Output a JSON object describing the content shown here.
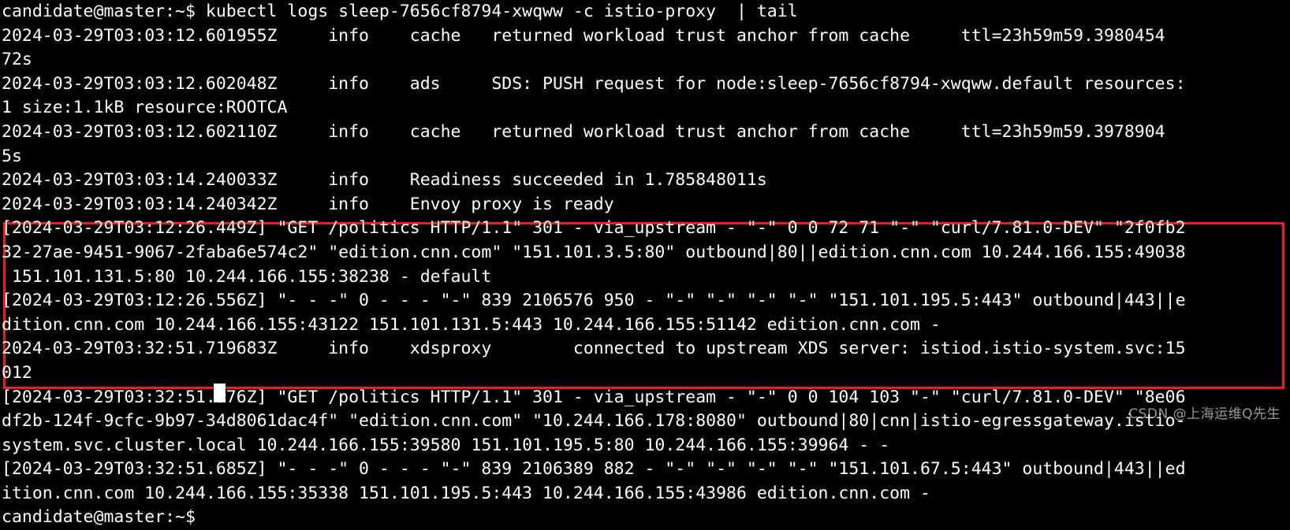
{
  "terminal": {
    "prompt": "candidate@master:~$",
    "command": "kubectl logs sleep-7656cf8794-xwqww -c istio-proxy  | tail",
    "background_color": "#000000",
    "text_color": "#ffffff",
    "highlight_color": "#f01b1b",
    "cursor": "block-cursor",
    "lines": [
      "candidate@master:~$ kubectl logs sleep-7656cf8794-xwqww -c istio-proxy  | tail",
      "2024-03-29T03:03:12.601955Z     info    cache   returned workload trust anchor from cache     ttl=23h59m59.3980454",
      "72s",
      "2024-03-29T03:03:12.602048Z     info    ads     SDS: PUSH request for node:sleep-7656cf8794-xwqww.default resources:",
      "1 size:1.1kB resource:ROOTCA",
      "2024-03-29T03:03:12.602110Z     info    cache   returned workload trust anchor from cache     ttl=23h59m59.3978904",
      "5s",
      "2024-03-29T03:03:14.240033Z     info    Readiness succeeded in 1.785848011s",
      "2024-03-29T03:03:14.240342Z     info    Envoy proxy is ready",
      "[2024-03-29T03:12:26.449Z] \"GET /politics HTTP/1.1\" 301 - via_upstream - \"-\" 0 0 72 71 \"-\" \"curl/7.81.0-DEV\" \"2f0fb2",
      "32-27ae-9451-9067-2faba6e574c2\" \"edition.cnn.com\" \"151.101.3.5:80\" outbound|80||edition.cnn.com 10.244.166.155:49038",
      " 151.101.131.5:80 10.244.166.155:38238 - default",
      "[2024-03-29T03:12:26.556Z] \"- - -\" 0 - - - \"-\" 839 2106576 950 - \"-\" \"-\" \"-\" \"-\" \"151.101.195.5:443\" outbound|443||e",
      "dition.cnn.com 10.244.166.155:43122 151.101.131.5:443 10.244.166.155:51142 edition.cnn.com -",
      "2024-03-29T03:32:51.719683Z     info    xdsproxy        connected to upstream XDS server: istiod.istio-system.svc:15",
      "012",
      "[2024-03-29T03:32:51.576Z] \"GET /politics HTTP/1.1\" 301 - via_upstream - \"-\" 0 0 104 103 \"-\" \"curl/7.81.0-DEV\" \"8e06",
      "df2b-124f-9cfc-9b97-34d8061dac4f\" \"edition.cnn.com\" \"10.244.166.178:8080\" outbound|80|cnn|istio-egressgateway.istio-",
      "system.svc.cluster.local 10.244.166.155:39580 151.101.195.5:80 10.244.166.155:39964 - -",
      "[2024-03-29T03:32:51.685Z] \"- - -\" 0 - - - \"-\" 839 2106389 882 - \"-\" \"-\" \"-\" \"-\" \"151.101.67.5:443\" outbound|443||ed",
      "ition.cnn.com 10.244.166.155:35338 151.101.195.5:443 10.244.166.155:43986 edition.cnn.com -",
      "candidate@master:~$ "
    ]
  },
  "watermark": {
    "text": "CSDN @上海运维Q先生"
  }
}
